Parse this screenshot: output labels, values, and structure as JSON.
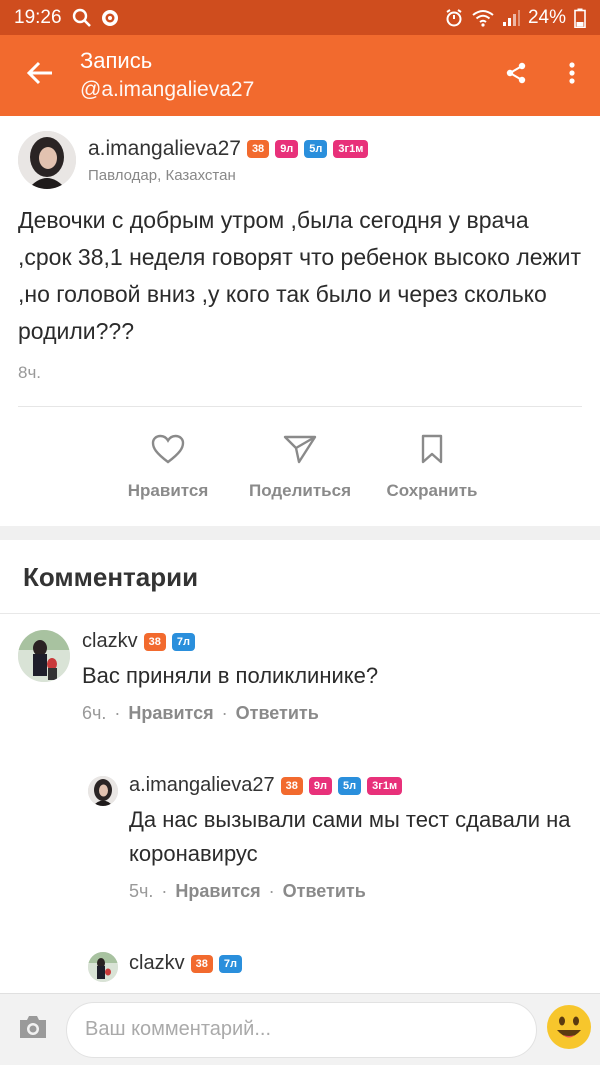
{
  "status_bar": {
    "time": "19:26",
    "battery": "24%"
  },
  "app_bar": {
    "title": "Запись",
    "subtitle": "@a.imangalieva27"
  },
  "post": {
    "author": "a.imangalieva27",
    "badges": [
      "38",
      "9л",
      "5л",
      "3г1м"
    ],
    "location": "Павлодар, Казахстан",
    "text": "Девочки с добрым утром ,была сегодня у врача ,срок 38,1 неделя говорят что ребенок высоко лежит ,но головой вниз ,у кого так было и через сколько родили???",
    "time": "8ч."
  },
  "actions": {
    "like": "Нравится",
    "share": "Поделиться",
    "save": "Сохранить"
  },
  "comments_title": "Комментарии",
  "comments": [
    {
      "author": "clazkv",
      "badges": [
        "38",
        "7л"
      ],
      "text": "Вас приняли в поликлинике?",
      "time": "6ч.",
      "like": "Нравится",
      "reply": "Ответить"
    },
    {
      "author": "a.imangalieva27",
      "badges": [
        "38",
        "9л",
        "5л",
        "3г1м"
      ],
      "text": "Да нас вызывали сами мы тест сдавали на коронавирус",
      "time": "5ч.",
      "like": "Нравится",
      "reply": "Ответить"
    },
    {
      "author": "clazkv",
      "badges": [
        "38",
        "7л"
      ]
    }
  ],
  "composer": {
    "placeholder": "Ваш комментарий..."
  },
  "colors": {
    "status_bar": "#cf4d1e",
    "app_bar": "#f26a2e",
    "badge_orange": "#f26a2e",
    "badge_pink": "#e8317a",
    "badge_blue": "#2a8fdc"
  }
}
